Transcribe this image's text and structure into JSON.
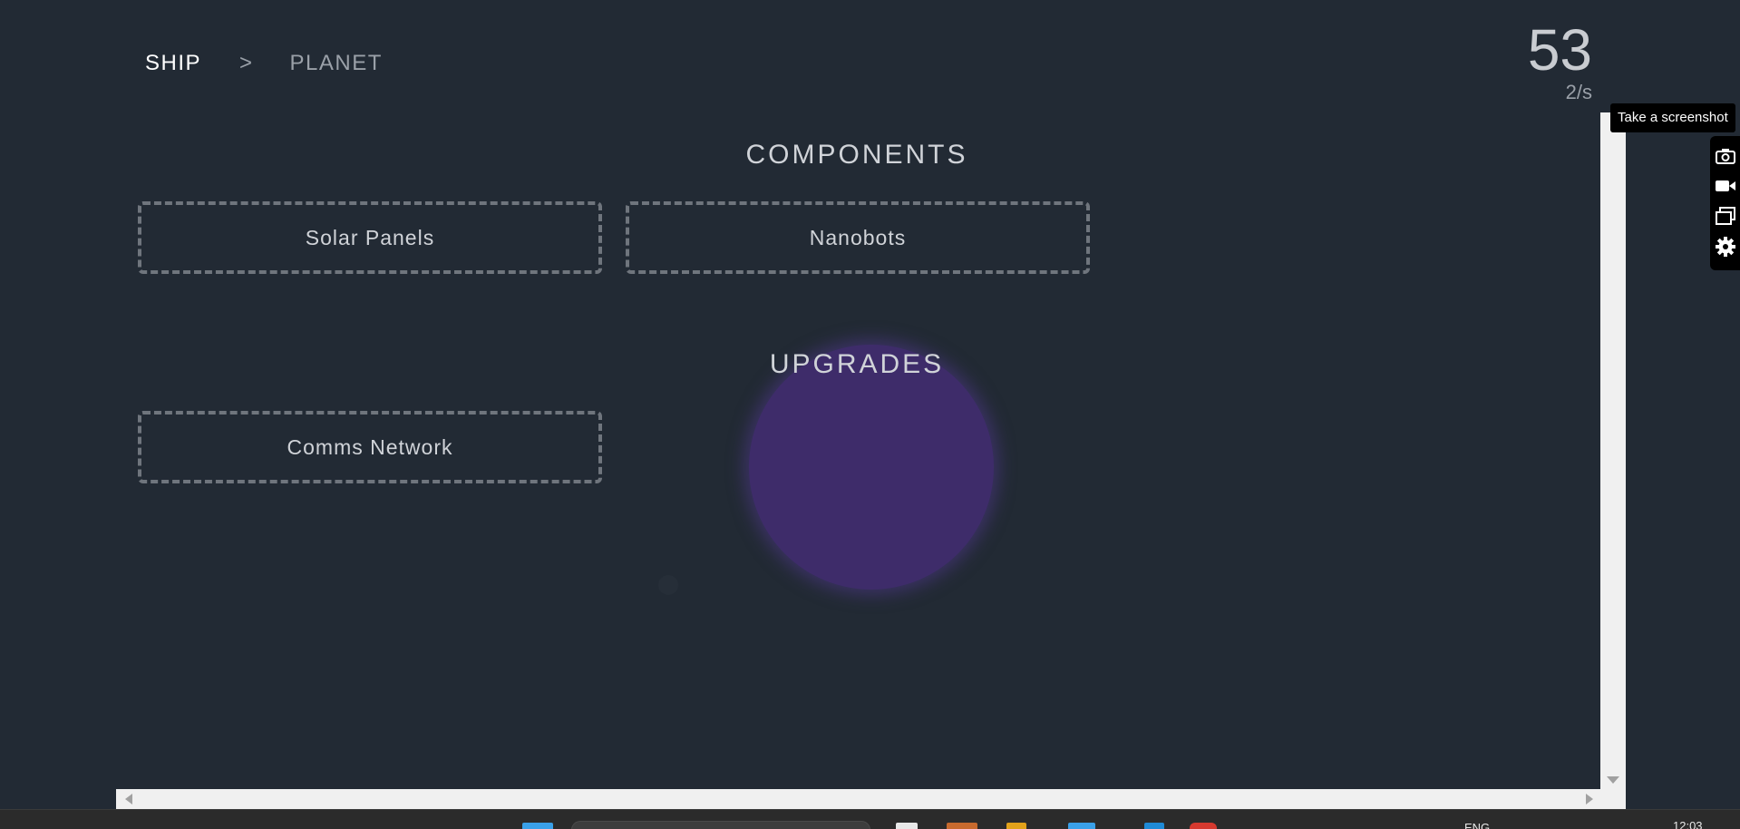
{
  "nav": {
    "ship_label": "SHIP",
    "separator": ">",
    "planet_label": "PLANET"
  },
  "resource": {
    "count": "53",
    "rate": "2/s"
  },
  "sections": {
    "components_title": "COMPONENTS",
    "upgrades_title": "UPGRADES"
  },
  "components": [
    {
      "label": "Solar Panels"
    },
    {
      "label": "Nanobots"
    }
  ],
  "upgrades": [
    {
      "label": "Comms Network"
    }
  ],
  "screenshot_tool": {
    "tooltip": "Take a screenshot",
    "icons": [
      "camera-icon",
      "video-camera-icon",
      "windows-icon",
      "gear-icon"
    ]
  },
  "taskbar": {
    "language": "ENG",
    "time": "12:03"
  },
  "colors": {
    "background": "#222a34",
    "planet": "#3e2c6a",
    "tile_border": "#6f757d"
  }
}
